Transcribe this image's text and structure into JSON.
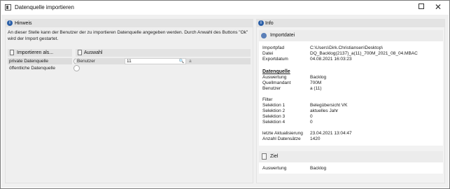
{
  "window": {
    "title": "Datenquelle importieren",
    "maximize_label": "",
    "close_label": "✕"
  },
  "hint": {
    "header": "Hinweis",
    "text": "An dieser Stelle kann der Benutzer der zu importieren Datenquelle angegeben werden. Durch Anwahl des Buttons \"Ok\" wird der Import gestartet."
  },
  "import_as": {
    "header": "Importieren als...",
    "options": [
      {
        "label": "private Datenquelle",
        "selected": true
      },
      {
        "label": "öffentliche Datenquelle",
        "selected": false
      }
    ]
  },
  "selection": {
    "header": "Auswahl",
    "user_label": "Benutzer",
    "user_value": "11",
    "user_suffix": "a"
  },
  "info": {
    "header": "Info",
    "import_file": {
      "header": "Importdatei",
      "rows": [
        {
          "key": "Importpfad",
          "value": "C:\\Users\\Dirk.Christiansen\\Desktop\\"
        },
        {
          "key": "Datei",
          "value": "DQ_Backlog(2137)_a(11)_700M_2021_08_04.MBAC"
        },
        {
          "key": "Exportdatum",
          "value": "04.08.2021 16:03:23"
        }
      ],
      "datasource_title": "Datenquelle",
      "datasource_rows": [
        {
          "key": "Auswertung",
          "value": "Backlog"
        },
        {
          "key": "Quellmandant",
          "value": "700M"
        },
        {
          "key": "Benutzer",
          "value": "a (11)"
        }
      ],
      "filter_title": "Filter",
      "filter_rows": [
        {
          "key": "Selektion 1",
          "value": "Belegübersicht VK"
        },
        {
          "key": "Selektion 2",
          "value": "aktuelles Jahr"
        },
        {
          "key": "Selektion 3",
          "value": "0"
        },
        {
          "key": "Selektion 4",
          "value": "0"
        }
      ],
      "update_rows": [
        {
          "key": "letzte Aktualisierung",
          "value": "23.04.2021 13:04:47"
        },
        {
          "key": "Anzahl Datensätze",
          "value": "1420"
        }
      ]
    },
    "target": {
      "header": "Ziel",
      "rows": [
        {
          "key": "Auswertung",
          "value": "Backlog"
        }
      ]
    }
  }
}
